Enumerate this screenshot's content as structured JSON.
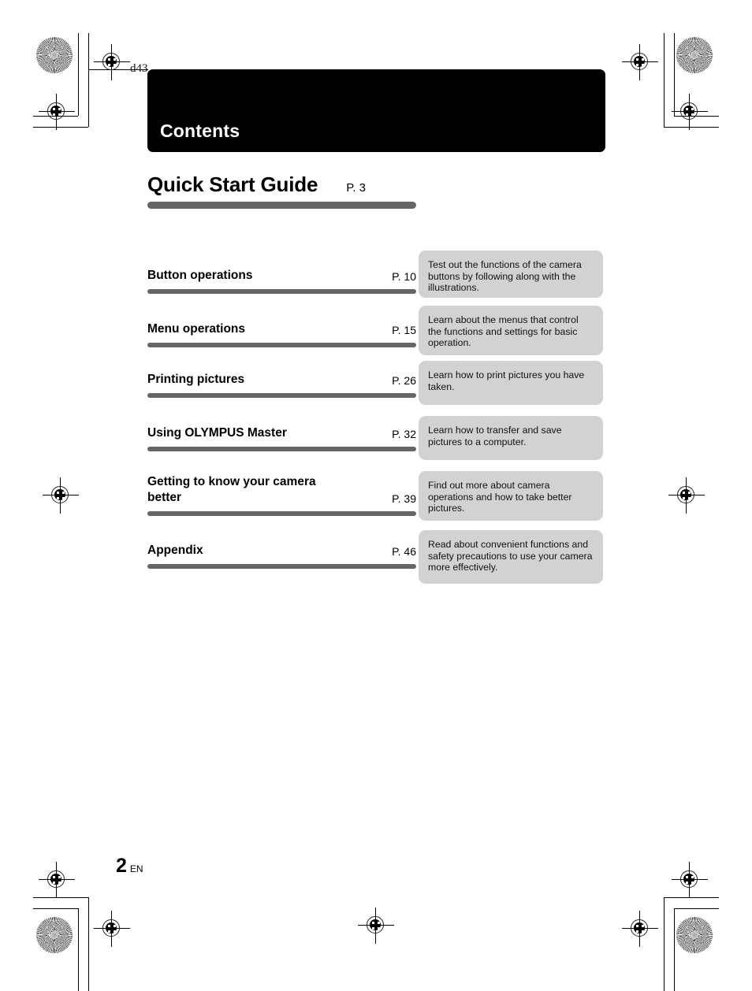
{
  "document": {
    "plate_code": "d43",
    "banner_title": "Contents",
    "folio_number": "2",
    "folio_language": "EN"
  },
  "headline": {
    "title": "Quick Start Guide",
    "page": "P. 3"
  },
  "entries": [
    {
      "title": "Button operations",
      "page": "P. 10",
      "description": "Test out the functions of the camera buttons by following along with the illustrations."
    },
    {
      "title": "Menu operations",
      "page": "P. 15",
      "description": "Learn about the menus that control the functions and settings for basic operation."
    },
    {
      "title": "Printing pictures",
      "page": "P. 26",
      "description": "Learn how to print pictures you have taken."
    },
    {
      "title": "Using OLYMPUS Master",
      "page": "P. 32",
      "description": "Learn how to transfer and save pictures to a computer."
    },
    {
      "title": "Getting to know your camera better",
      "page": "P. 39",
      "description": "Find out more about camera operations and how to take better pictures."
    },
    {
      "title": "Appendix",
      "page": "P. 46",
      "description": "Read about convenient functions and safety precautions to use your camera more effectively."
    }
  ],
  "colors": {
    "banner_background": "#000000",
    "rule_gray": "#666666",
    "description_background": "#d2d2d2"
  }
}
